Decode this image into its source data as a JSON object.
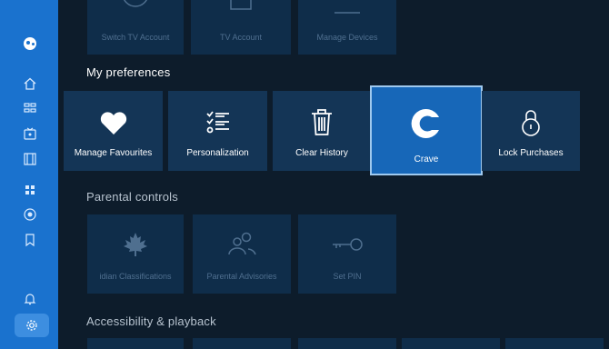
{
  "sidebar": {
    "items": [
      {
        "icon": "home-icon"
      },
      {
        "icon": "guide-icon"
      },
      {
        "icon": "live-tv-icon"
      },
      {
        "icon": "movies-icon"
      },
      {
        "icon": "apps-icon"
      },
      {
        "icon": "record-icon"
      },
      {
        "icon": "bookmark-icon"
      },
      {
        "icon": "bell-icon"
      },
      {
        "icon": "gear-icon"
      }
    ],
    "accent": "#1a72ce"
  },
  "account_row": {
    "tiles": [
      {
        "label": "Switch TV Account"
      },
      {
        "label": "TV Account"
      },
      {
        "label": "Manage Devices"
      }
    ]
  },
  "preferences": {
    "heading": "My preferences",
    "tiles": [
      {
        "label": "Manage Favourites",
        "icon": "heart-icon"
      },
      {
        "label": "Personalization",
        "icon": "checklist-icon"
      },
      {
        "label": "Clear History",
        "icon": "trash-icon"
      },
      {
        "label": "Crave",
        "icon": "crave-logo-icon",
        "focused": true
      },
      {
        "label": "Lock Purchases",
        "icon": "lock-icon"
      }
    ]
  },
  "parental": {
    "heading": "Parental controls",
    "tiles": [
      {
        "label": "idian Classifications",
        "icon": "maple-leaf-icon"
      },
      {
        "label": "Parental Advisories",
        "icon": "people-icon"
      },
      {
        "label": "Set PIN",
        "icon": "key-icon"
      }
    ]
  },
  "accessibility": {
    "heading": "Accessibility & playback"
  }
}
